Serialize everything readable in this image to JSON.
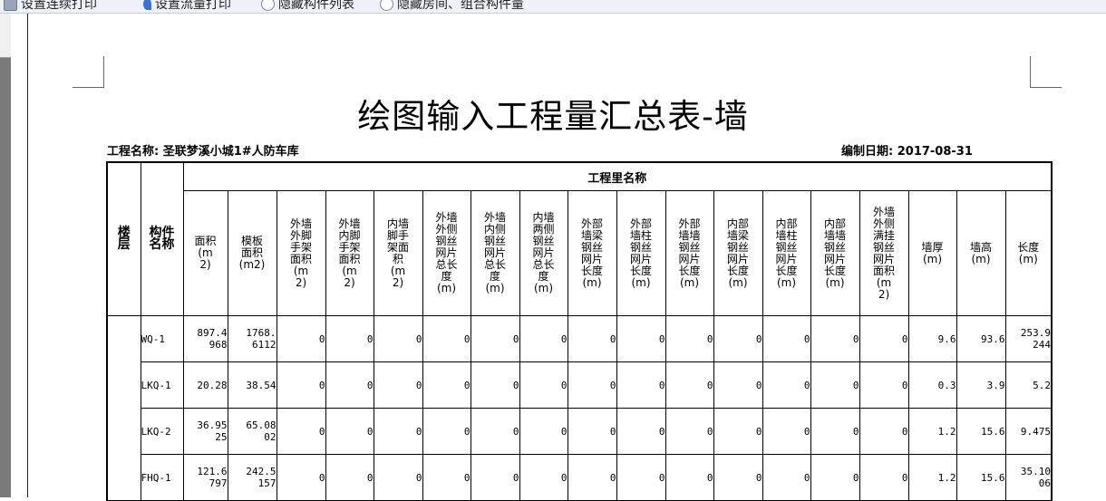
{
  "toolbar": {
    "items": [
      {
        "label": "设置连续打印",
        "icon": "print-setup-icon"
      },
      {
        "label": "设置流量打印",
        "icon": "flow-print-icon"
      },
      {
        "label": "隐藏构件列表",
        "icon": "hide-list-icon"
      },
      {
        "label": "隐藏房间、组合构件量",
        "icon": "hide-room-icon"
      }
    ]
  },
  "document": {
    "title": "绘图输入工程量汇总表-墙",
    "project_label": "工程名称: 圣联梦溪小城1#人防车库",
    "date_label": "编制日期: 2017-08-31"
  },
  "table": {
    "group_header": "工程里名称",
    "col_floor": "楼层",
    "col_component": "构件名称",
    "columns": [
      "面积(m2)",
      "模板面积(m2)",
      "外墙外脚手架面积(m2)",
      "外墙内脚手架面积(m2)",
      "内墙脚手架面积(m2)",
      "外墙外侧钢丝网片总长度(m)",
      "外墙内侧钢丝网片总长度(m)",
      "内墙两侧钢丝网片总长度(m)",
      "外部墙梁钢丝网片长度(m)",
      "外部墙柱钢丝网片长度(m)",
      "外部墙墙钢丝网片长度(m)",
      "内部墙梁钢丝网片长度(m)",
      "内部墙柱钢丝网片长度(m)",
      "内部墙墙钢丝网片长度(m)",
      "外墙外侧满挂钢丝网片面积(m2)",
      "墙厚(m)",
      "墙高(m)",
      "长度(m)"
    ],
    "rows": [
      {
        "name": "WQ-1",
        "values": [
          "897.4968",
          "1768.6112",
          "0",
          "0",
          "0",
          "0",
          "0",
          "0",
          "0",
          "0",
          "0",
          "0",
          "0",
          "0",
          "0",
          "9.6",
          "93.6",
          "253.9244"
        ]
      },
      {
        "name": "LKQ-1",
        "values": [
          "20.28",
          "38.54",
          "0",
          "0",
          "0",
          "0",
          "0",
          "0",
          "0",
          "0",
          "0",
          "0",
          "0",
          "0",
          "0",
          "0.3",
          "3.9",
          "5.2"
        ]
      },
      {
        "name": "LKQ-2",
        "values": [
          "36.9525",
          "65.0802",
          "0",
          "0",
          "0",
          "0",
          "0",
          "0",
          "0",
          "0",
          "0",
          "0",
          "0",
          "0",
          "0",
          "1.2",
          "15.6",
          "9.475"
        ]
      },
      {
        "name": "FHQ-1",
        "values": [
          "121.6797",
          "242.5157",
          "0",
          "0",
          "0",
          "0",
          "0",
          "0",
          "0",
          "0",
          "0",
          "0",
          "0",
          "0",
          "0",
          "1.2",
          "15.6",
          "35.1006"
        ]
      }
    ]
  },
  "colors": {
    "toolbar_bg": "#eef2f8",
    "left_panel": "#7a7a7a",
    "text": "#000000"
  }
}
